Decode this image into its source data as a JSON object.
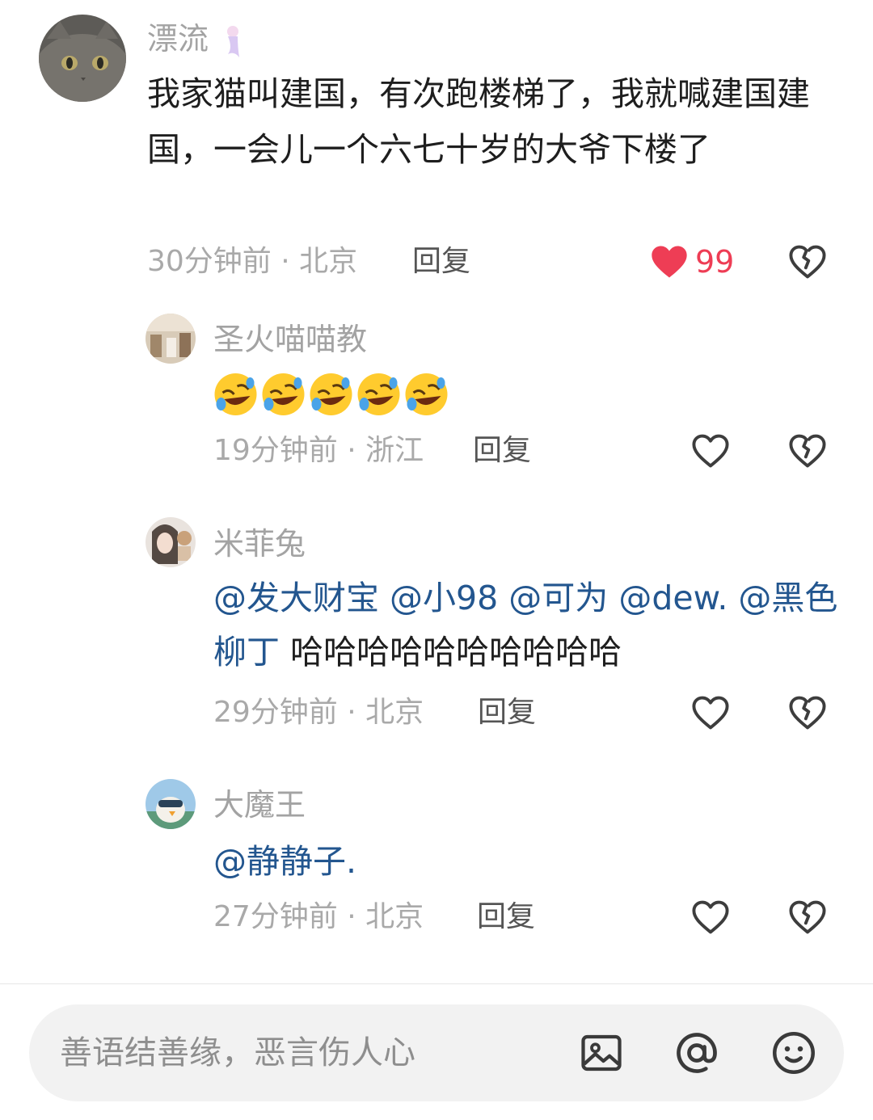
{
  "comment": {
    "username": "漂流",
    "text": "我家猫叫建国，有次跑楼梯了，我就喊建国建国，一会儿一个六七十岁的大爷下楼了",
    "meta": "30分钟前 · 北京",
    "reply_label": "回复",
    "like_count": "99",
    "liked": true,
    "like_color": "#ee3d55"
  },
  "replies": [
    {
      "username": "圣火喵喵教",
      "content_type": "emoji",
      "emoji": "rolling-on-floor-laughing",
      "emoji_count": 5,
      "meta": "19分钟前 · 浙江",
      "reply_label": "回复"
    },
    {
      "username": "米菲兔",
      "mentions": [
        "@发大财宝",
        "@小98",
        "@可为",
        "@dew.",
        "@黑色柳丁"
      ],
      "text": "哈哈哈哈哈哈哈哈哈哈",
      "meta": "29分钟前 · 北京",
      "reply_label": "回复"
    },
    {
      "username": "大魔王",
      "mentions": [
        "@静静子."
      ],
      "meta": "27分钟前 · 北京",
      "reply_label": "回复"
    }
  ],
  "input_bar": {
    "placeholder": "善语结善缘，恶言伤人心",
    "icons": [
      "image-icon",
      "at-icon",
      "emoji-icon"
    ]
  },
  "colors": {
    "mention": "#23568f",
    "meta": "#a9a9a9",
    "username": "#a3a3a3"
  }
}
